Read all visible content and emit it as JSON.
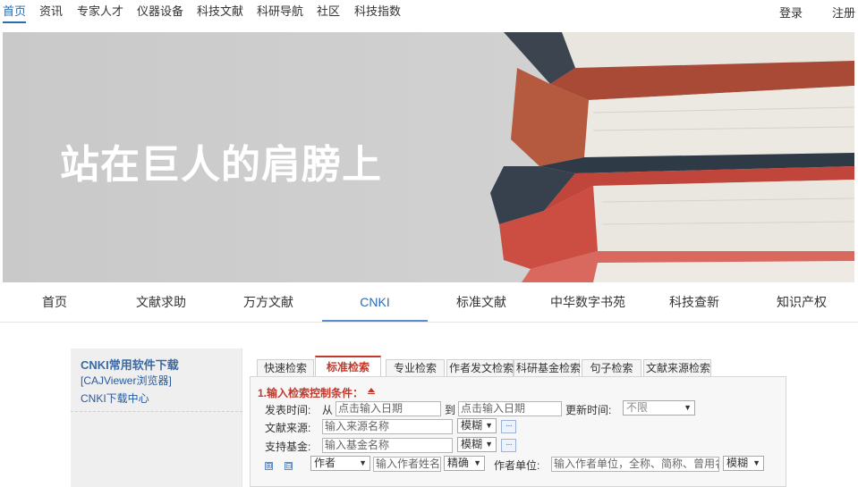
{
  "top_nav": {
    "items": [
      "首页",
      "资讯",
      "专家人才",
      "仪器设备",
      "科技文献",
      "科研导航",
      "社区",
      "科技指数"
    ],
    "login": "登录",
    "register": "注册"
  },
  "banner": {
    "slogan": "站在巨人的肩膀上"
  },
  "sub_nav": {
    "tabs": [
      "首页",
      "文献求助",
      "万方文献",
      "CNKI",
      "标准文献",
      "中华数字书苑",
      "科技查新",
      "知识产权"
    ],
    "active": "CNKI"
  },
  "left_panel": {
    "title": "CNKI常用软件下载",
    "links": [
      "[CAJViewer浏览器]",
      "CNKI下载中心"
    ]
  },
  "search": {
    "tabs": [
      "快速检索",
      "标准检索",
      "专业检索",
      "作者发文检索",
      "科研基金检索",
      "句子检索",
      "文献来源检索"
    ],
    "active_tab": "标准检索",
    "condition_title": "1.输入检索控制条件：",
    "pub_time_label": "发表时间:",
    "from_label": "从",
    "to_label": "到",
    "date_from_placeholder": "点击输入日期",
    "date_to_placeholder": "点击输入日期",
    "update_time_label": "更新时间:",
    "update_time_value": "不限",
    "source_label": "文献来源:",
    "source_placeholder": "输入来源名称",
    "source_match": "模糊",
    "fund_label": "支持基金:",
    "fund_placeholder": "输入基金名称",
    "fund_match": "模糊",
    "author_field": "作者",
    "author_placeholder": "输入作者姓名",
    "author_match": "精确",
    "author_unit_label": "作者单位:",
    "author_unit_placeholder": "输入作者单位，全称、简称、曾用名均可",
    "author_unit_match": "模糊",
    "more_button": "···",
    "add_icon": "⊞",
    "remove_icon": "⊟"
  },
  "colors": {
    "accent_blue": "#2a6bb3",
    "accent_red": "#c0392b"
  }
}
